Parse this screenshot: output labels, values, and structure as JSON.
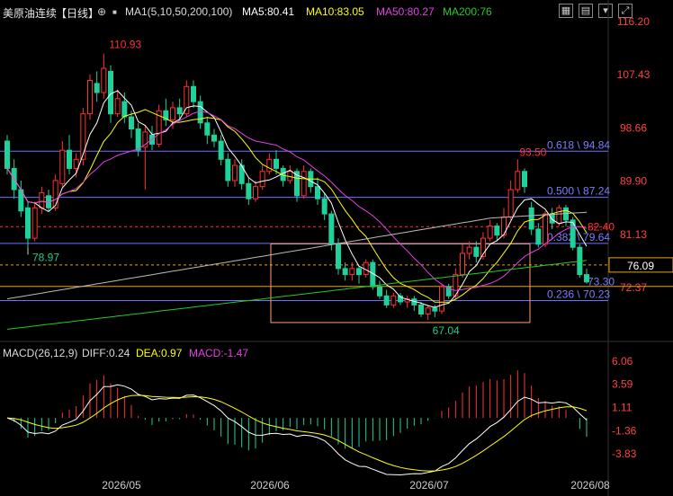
{
  "header": {
    "symbol": "美原油连续",
    "period": "【日线】",
    "ma_title": "MA1(5,10,50,200,100)",
    "ma5": "MA5:80.41",
    "ma10": "MA10:83.05",
    "ma50": "MA50:80.27",
    "ma200": "MA200:76",
    "icons": [
      "target-icon",
      "grid-icon",
      "list-icon",
      "arrow-down-icon",
      "expand-icon"
    ]
  },
  "macd_header": {
    "title": "MACD(26,12,9)",
    "diff": "DIFF:0.24",
    "dea": "DEA:0.97",
    "macd": "MACD:-1.47"
  },
  "colors": {
    "up": "#ff3232",
    "down": "#1fd19b",
    "ma5": "#ffffff",
    "ma10": "#ffff00",
    "ma50": "#e040e0",
    "ma200": "#22cc22",
    "ma100": "#bbbbbb",
    "fib": "#7070ff",
    "price_axis": "#ff4040"
  },
  "chart_data": [
    {
      "type": "candlestick",
      "ylim": [
        67,
        116.2
      ],
      "y_ticks": [
        "116.20",
        "107.43",
        "98.66",
        "89.90",
        "81.13",
        "72.37"
      ],
      "x_ticks": [
        "2026/05",
        "2026/06",
        "2026/07",
        "2026/08"
      ],
      "annotations": {
        "high": "110.93",
        "low_left": "78.97",
        "low": "67.04",
        "recent_high": "93.50",
        "dashed_level": "82.40",
        "last": "73.30",
        "current_price": "76.09"
      },
      "fib_levels": [
        {
          "label": "0.618 \\ 94.84",
          "value": 94.84
        },
        {
          "label": "0.500 \\ 87.24",
          "value": 87.24
        },
        {
          "label": "0.382 \\ 79.64",
          "value": 79.64
        },
        {
          "label": "0.236 \\ 70.23",
          "value": 70.23
        }
      ],
      "candles": [
        {
          "o": 96.5,
          "c": 92.0,
          "h": 97.5,
          "l": 91.0
        },
        {
          "o": 92.0,
          "c": 88.5,
          "h": 93.5,
          "l": 87.0
        },
        {
          "o": 88.5,
          "c": 85.0,
          "h": 90.0,
          "l": 84.0
        },
        {
          "o": 85.5,
          "c": 80.5,
          "h": 86.5,
          "l": 78.97
        },
        {
          "o": 80.5,
          "c": 85.5,
          "h": 86.5,
          "l": 80.0
        },
        {
          "o": 85.5,
          "c": 88.0,
          "h": 89.0,
          "l": 84.5
        },
        {
          "o": 87.5,
          "c": 85.5,
          "h": 88.5,
          "l": 85.0
        },
        {
          "o": 85.5,
          "c": 90.0,
          "h": 91.0,
          "l": 85.0
        },
        {
          "o": 89.5,
          "c": 95.0,
          "h": 96.5,
          "l": 89.0
        },
        {
          "o": 95.0,
          "c": 92.0,
          "h": 97.5,
          "l": 91.0
        },
        {
          "o": 92.0,
          "c": 93.5,
          "h": 94.5,
          "l": 90.5
        },
        {
          "o": 93.5,
          "c": 101.0,
          "h": 102.0,
          "l": 92.5
        },
        {
          "o": 101.0,
          "c": 106.5,
          "h": 107.5,
          "l": 100.0
        },
        {
          "o": 106.0,
          "c": 104.5,
          "h": 108.0,
          "l": 103.0
        },
        {
          "o": 104.5,
          "c": 108.5,
          "h": 110.93,
          "l": 103.5
        },
        {
          "o": 108.0,
          "c": 101.0,
          "h": 109.0,
          "l": 99.5
        },
        {
          "o": 101.0,
          "c": 103.5,
          "h": 105.0,
          "l": 100.5
        },
        {
          "o": 103.0,
          "c": 100.5,
          "h": 104.5,
          "l": 99.5
        },
        {
          "o": 100.5,
          "c": 98.5,
          "h": 101.5,
          "l": 97.0
        },
        {
          "o": 98.5,
          "c": 95.0,
          "h": 99.5,
          "l": 94.0
        },
        {
          "o": 95.5,
          "c": 98.0,
          "h": 99.0,
          "l": 88.5
        },
        {
          "o": 97.5,
          "c": 96.0,
          "h": 99.0,
          "l": 95.0
        },
        {
          "o": 96.0,
          "c": 101.5,
          "h": 102.5,
          "l": 95.5
        },
        {
          "o": 101.5,
          "c": 100.0,
          "h": 103.5,
          "l": 99.0
        },
        {
          "o": 100.0,
          "c": 102.0,
          "h": 103.0,
          "l": 98.5
        },
        {
          "o": 102.0,
          "c": 101.0,
          "h": 103.5,
          "l": 100.0
        },
        {
          "o": 101.0,
          "c": 105.5,
          "h": 106.5,
          "l": 100.5
        },
        {
          "o": 105.5,
          "c": 103.0,
          "h": 106.5,
          "l": 102.0
        },
        {
          "o": 103.0,
          "c": 99.5,
          "h": 104.0,
          "l": 98.5
        },
        {
          "o": 99.5,
          "c": 97.5,
          "h": 100.5,
          "l": 96.0
        },
        {
          "o": 97.5,
          "c": 96.5,
          "h": 98.5,
          "l": 95.5
        },
        {
          "o": 96.5,
          "c": 93.5,
          "h": 97.5,
          "l": 92.5
        },
        {
          "o": 93.5,
          "c": 90.0,
          "h": 94.5,
          "l": 89.0
        },
        {
          "o": 90.0,
          "c": 92.5,
          "h": 93.5,
          "l": 89.0
        },
        {
          "o": 92.5,
          "c": 89.5,
          "h": 93.5,
          "l": 88.5
        },
        {
          "o": 89.5,
          "c": 87.0,
          "h": 90.5,
          "l": 86.0
        },
        {
          "o": 87.0,
          "c": 89.0,
          "h": 90.0,
          "l": 86.5
        },
        {
          "o": 89.0,
          "c": 91.5,
          "h": 92.5,
          "l": 88.5
        },
        {
          "o": 91.5,
          "c": 93.5,
          "h": 94.5,
          "l": 91.0
        },
        {
          "o": 93.5,
          "c": 92.0,
          "h": 95.0,
          "l": 91.0
        },
        {
          "o": 92.0,
          "c": 90.0,
          "h": 92.5,
          "l": 89.0
        },
        {
          "o": 90.0,
          "c": 91.5,
          "h": 92.5,
          "l": 89.5
        },
        {
          "o": 91.5,
          "c": 87.5,
          "h": 92.0,
          "l": 86.5
        },
        {
          "o": 87.5,
          "c": 91.5,
          "h": 92.5,
          "l": 87.0
        },
        {
          "o": 91.5,
          "c": 89.0,
          "h": 92.0,
          "l": 88.0
        },
        {
          "o": 89.0,
          "c": 87.0,
          "h": 90.5,
          "l": 86.0
        },
        {
          "o": 87.0,
          "c": 84.5,
          "h": 88.0,
          "l": 83.5
        },
        {
          "o": 84.5,
          "c": 79.5,
          "h": 85.0,
          "l": 78.5
        },
        {
          "o": 79.5,
          "c": 75.5,
          "h": 80.5,
          "l": 74.5
        },
        {
          "o": 75.5,
          "c": 74.5,
          "h": 76.5,
          "l": 73.5
        },
        {
          "o": 74.5,
          "c": 75.5,
          "h": 76.5,
          "l": 73.5
        },
        {
          "o": 75.5,
          "c": 74.5,
          "h": 76.0,
          "l": 73.0
        },
        {
          "o": 74.5,
          "c": 76.5,
          "h": 77.0,
          "l": 74.0
        },
        {
          "o": 76.5,
          "c": 72.5,
          "h": 77.0,
          "l": 72.0
        },
        {
          "o": 72.5,
          "c": 71.0,
          "h": 73.5,
          "l": 70.5
        },
        {
          "o": 71.0,
          "c": 69.5,
          "h": 72.0,
          "l": 69.0
        },
        {
          "o": 69.5,
          "c": 71.0,
          "h": 71.5,
          "l": 69.0
        },
        {
          "o": 71.0,
          "c": 70.0,
          "h": 71.5,
          "l": 69.5
        },
        {
          "o": 70.0,
          "c": 70.5,
          "h": 71.0,
          "l": 69.0
        },
        {
          "o": 70.5,
          "c": 69.5,
          "h": 71.0,
          "l": 68.5
        },
        {
          "o": 69.5,
          "c": 68.0,
          "h": 70.0,
          "l": 67.5
        },
        {
          "o": 68.0,
          "c": 69.0,
          "h": 69.5,
          "l": 67.04
        },
        {
          "o": 69.0,
          "c": 68.5,
          "h": 69.5,
          "l": 67.5
        },
        {
          "o": 68.5,
          "c": 72.5,
          "h": 73.0,
          "l": 68.0
        },
        {
          "o": 72.5,
          "c": 71.0,
          "h": 73.0,
          "l": 70.5
        },
        {
          "o": 71.0,
          "c": 74.5,
          "h": 75.5,
          "l": 70.5
        },
        {
          "o": 74.5,
          "c": 78.0,
          "h": 79.5,
          "l": 74.0
        },
        {
          "o": 78.0,
          "c": 79.0,
          "h": 80.0,
          "l": 77.0
        },
        {
          "o": 79.0,
          "c": 77.5,
          "h": 80.0,
          "l": 76.5
        },
        {
          "o": 77.5,
          "c": 80.5,
          "h": 81.5,
          "l": 77.0
        },
        {
          "o": 80.5,
          "c": 82.5,
          "h": 83.5,
          "l": 80.0
        },
        {
          "o": 82.5,
          "c": 81.0,
          "h": 83.0,
          "l": 80.0
        },
        {
          "o": 81.0,
          "c": 84.0,
          "h": 85.5,
          "l": 80.5
        },
        {
          "o": 84.0,
          "c": 88.5,
          "h": 90.0,
          "l": 83.5
        },
        {
          "o": 88.5,
          "c": 91.5,
          "h": 93.5,
          "l": 88.0
        },
        {
          "o": 91.5,
          "c": 89.0,
          "h": 92.0,
          "l": 88.0
        },
        {
          "o": 85.5,
          "c": 82.0,
          "h": 86.5,
          "l": 81.0
        },
        {
          "o": 82.0,
          "c": 79.5,
          "h": 83.0,
          "l": 79.0
        },
        {
          "o": 79.5,
          "c": 84.5,
          "h": 85.0,
          "l": 79.0
        },
        {
          "o": 84.5,
          "c": 83.0,
          "h": 85.5,
          "l": 82.0
        },
        {
          "o": 83.0,
          "c": 85.5,
          "h": 86.0,
          "l": 82.5
        },
        {
          "o": 85.5,
          "c": 83.5,
          "h": 86.0,
          "l": 82.5
        },
        {
          "o": 83.5,
          "c": 79.0,
          "h": 84.0,
          "l": 78.5
        },
        {
          "o": 79.0,
          "c": 74.5,
          "h": 79.5,
          "l": 74.0
        },
        {
          "o": 74.5,
          "c": 73.3,
          "h": 75.5,
          "l": 73.0
        }
      ],
      "series": [
        {
          "name": "MA5"
        },
        {
          "name": "MA10"
        },
        {
          "name": "MA50"
        },
        {
          "name": "MA200"
        }
      ]
    },
    {
      "type": "bar",
      "ylim": [
        -5,
        7.5
      ],
      "y_ticks": [
        "6.06",
        "3.59",
        "1.11",
        "-1.36",
        "-3.83"
      ],
      "series": [
        {
          "name": "DIFF"
        },
        {
          "name": "DEA"
        },
        {
          "name": "MACD"
        }
      ]
    }
  ]
}
